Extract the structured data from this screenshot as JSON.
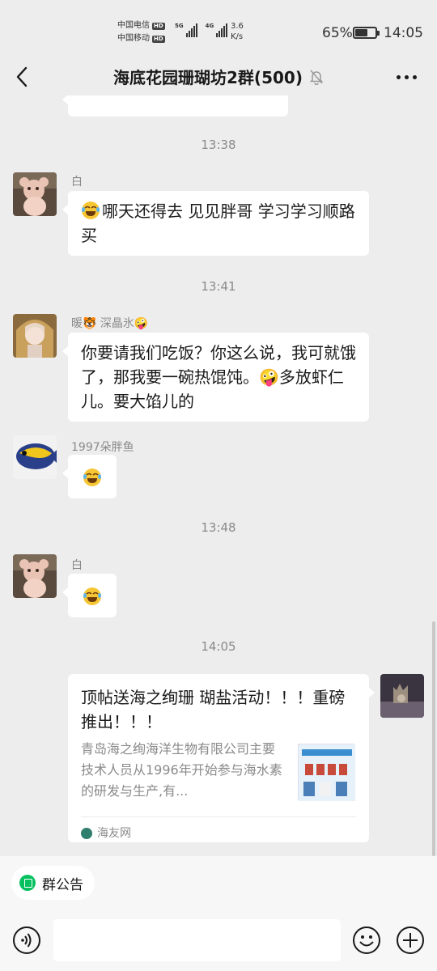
{
  "status_bar": {
    "carrier1": "中国电信",
    "carrier2": "中国移动",
    "hd": "HD",
    "net1": "5G",
    "net2": "4G",
    "speed_value": "3.6",
    "speed_unit": "K/s",
    "battery_percent": "65%",
    "battery_level": 0.65,
    "time": "14:05"
  },
  "header": {
    "title": "海底花园珊瑚坊2群(500)",
    "back_icon": "chevron-left-icon",
    "mute_icon": "bell-off-icon",
    "more_icon": "more-dots-icon"
  },
  "messages": [
    {
      "type": "timestamp",
      "text": "13:38"
    },
    {
      "type": "text",
      "sender": "白",
      "emoji": "laugh-cry",
      "text": "哪天还得去 见见胖哥 学习学习顺路买"
    },
    {
      "type": "timestamp",
      "text": "13:41"
    },
    {
      "type": "text",
      "sender": "暖🐯 深晶氷🤪",
      "text": "你要请我们吃饭？你这么说，我可就饿了，那我要一碗热馄饨。🤪多放虾仁儿。要大馅儿的"
    },
    {
      "type": "emoji",
      "sender": "1997朵胖鱼",
      "emoji": "laugh-cry"
    },
    {
      "type": "timestamp",
      "text": "13:48"
    },
    {
      "type": "emoji",
      "sender": "白",
      "emoji": "laugh-cry"
    },
    {
      "type": "timestamp",
      "text": "14:05"
    },
    {
      "type": "link_card",
      "title": "顶帖送海之绚珊 瑚盐活动！！！重磅推出！！！",
      "description": "青岛海之绚海洋生物有限公司主要技术人员从1996年开始参与海水素的研发与生产,有...",
      "source": "海友网"
    }
  ],
  "bottom": {
    "notice_label": "群公告",
    "input_value": "",
    "voice_icon": "voice-icon",
    "emoji_icon": "smile-icon",
    "plus_icon": "plus-circle-icon"
  },
  "colors": {
    "background": "#ededed",
    "bubble": "#ffffff",
    "accent": "#07c160",
    "muted_text": "#8a8a8a"
  }
}
